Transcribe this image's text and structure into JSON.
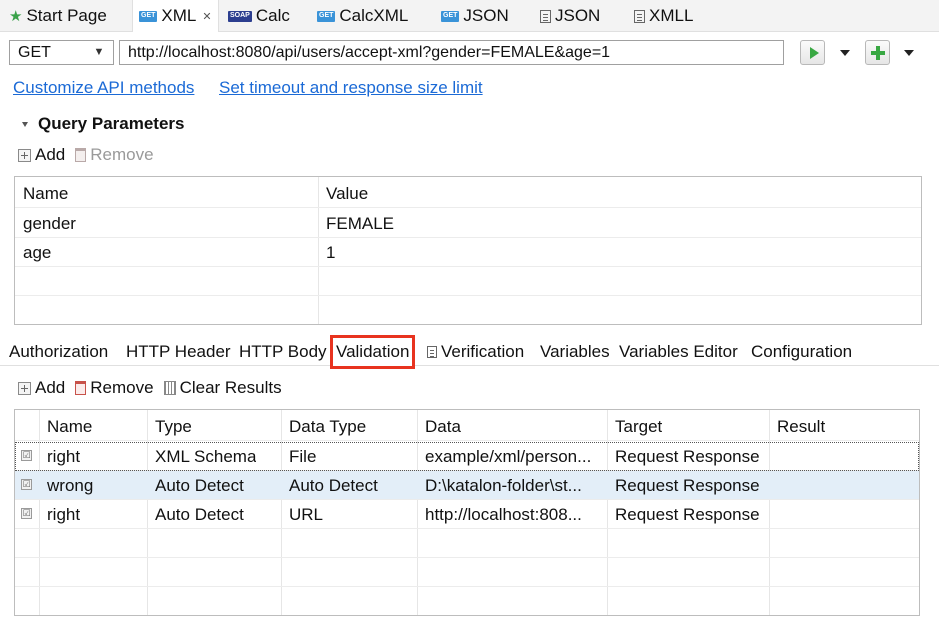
{
  "tabs": [
    {
      "label": "Start Page",
      "icon": "star-icon",
      "active": false
    },
    {
      "label": "XML",
      "icon": "get-badge-icon",
      "badge": "GET",
      "active": true,
      "closable": true
    },
    {
      "label": "Calc",
      "icon": "soap-badge-icon",
      "badge": "SOAP",
      "active": false
    },
    {
      "label": "CalcXML",
      "icon": "get-badge-icon",
      "badge": "GET",
      "active": false
    },
    {
      "label": "JSON",
      "icon": "get-badge-icon",
      "badge": "GET",
      "active": false
    },
    {
      "label": "JSON",
      "icon": "document-icon",
      "active": false
    },
    {
      "label": "XMLL",
      "icon": "document-icon",
      "active": false
    }
  ],
  "request": {
    "method": "GET",
    "url": "http://localhost:8080/api/users/accept-xml?gender=FEMALE&age=1"
  },
  "links": {
    "customize": "Customize API methods",
    "timeout": "Set timeout and response size limit"
  },
  "query": {
    "title": "Query Parameters",
    "add_label": "Add",
    "remove_label": "Remove",
    "headers": [
      "Name",
      "Value"
    ],
    "rows": [
      {
        "name": "gender",
        "value": "FEMALE"
      },
      {
        "name": "age",
        "value": "1"
      }
    ]
  },
  "param_tabs": [
    {
      "label": "Authorization"
    },
    {
      "label": "HTTP Header"
    },
    {
      "label": "HTTP Body"
    },
    {
      "label": "Validation",
      "selected": true
    },
    {
      "label": "Verification",
      "icon": "script-icon"
    },
    {
      "label": "Variables"
    },
    {
      "label": "Variables Editor"
    },
    {
      "label": "Configuration"
    }
  ],
  "validation": {
    "add_label": "Add",
    "remove_label": "Remove",
    "clear_label": "Clear Results",
    "headers": [
      "Name",
      "Type",
      "Data Type",
      "Data",
      "Target",
      "Result"
    ],
    "rows": [
      {
        "name": "right",
        "type": "XML Schema",
        "data_type": "File",
        "data": "example/xml/person...",
        "target": "Request Response",
        "result": ""
      },
      {
        "name": "wrong",
        "type": "Auto Detect",
        "data_type": "Auto Detect",
        "data": "D:\\katalon-folder\\st...",
        "target": "Request Response",
        "result": ""
      },
      {
        "name": "right",
        "type": "Auto Detect",
        "data_type": "URL",
        "data": "http://localhost:808...",
        "target": "Request Response",
        "result": ""
      }
    ]
  },
  "colors": {
    "link": "#1b6ad6",
    "selected_tab_outline": "#e8331f",
    "run_green": "#39a843",
    "selected_row": "#e3eef8"
  }
}
